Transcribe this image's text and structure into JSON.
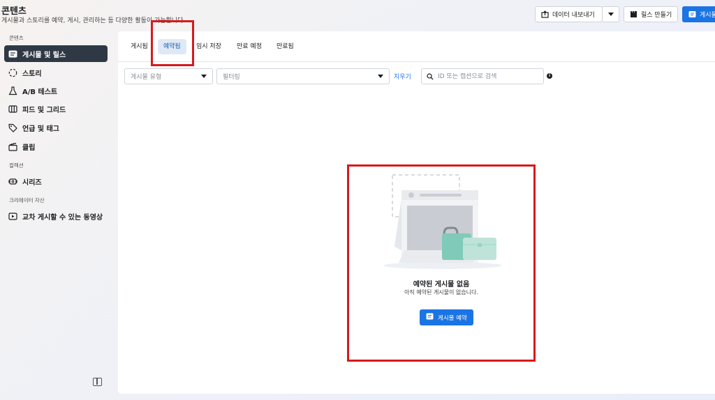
{
  "header": {
    "title": "콘텐츠",
    "subtitle": "게시물과 스토리를 예약, 게시, 관리하는 등 다양한 활동이 가능합니다.",
    "export_label": "데이터 내보내기",
    "reels_label": "릴스 만들기",
    "post_label": "게시물"
  },
  "sidebar": {
    "section_content": "콘텐츠",
    "section_collections": "컬렉션",
    "section_creator": "크리에이터 자산",
    "items": [
      {
        "label": "게시물 및 릴스"
      },
      {
        "label": "스토리"
      },
      {
        "label": "A/B 테스트"
      },
      {
        "label": "피드 및 그리드"
      },
      {
        "label": "언급 및 태그"
      },
      {
        "label": "클립"
      },
      {
        "label": "시리즈"
      },
      {
        "label": "교차 게시할 수 있는 동영상"
      }
    ]
  },
  "tabs": [
    {
      "label": "게시됨"
    },
    {
      "label": "예약됨"
    },
    {
      "label": "임시 저장"
    },
    {
      "label": "만료 예정"
    },
    {
      "label": "만료됨"
    }
  ],
  "filters": {
    "post_type_placeholder": "게시물 유형",
    "filter_placeholder": "필터링",
    "clear_label": "지우기",
    "search_placeholder": "ID 또는 캡션으로 검색"
  },
  "empty_state": {
    "title": "예약된 게시물 없음",
    "subtitle": "아직 예약된 게시물이 없습니다.",
    "button_label": "게시물 예약"
  },
  "colors": {
    "accent": "#1b74e4",
    "sidebar_active": "#2f3946",
    "highlight": "#d7191c"
  }
}
